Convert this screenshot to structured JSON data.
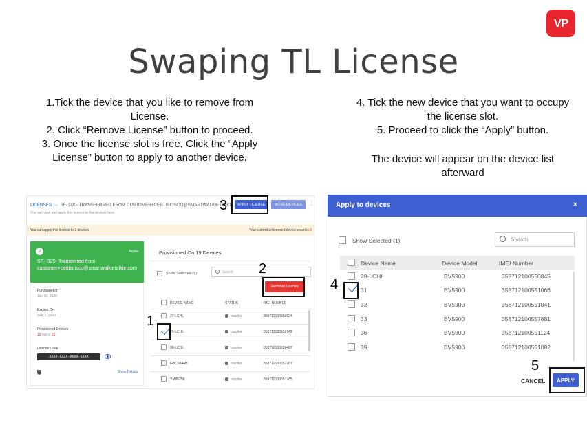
{
  "logo": {
    "text": "VP"
  },
  "title": "Swaping TL License",
  "steps_left": [
    "1.Tick the device that you like to remove from License.",
    "2. Click “Remove  License” button to proceed.",
    "3. Once the license slot is free, Click the “Apply License” button to apply to another device."
  ],
  "steps_right": [
    "4. Tick the new device that you want to occupy the license slot.",
    "5. Proceed to click the “Apply” button.",
    "The device will appear on the device list afterward"
  ],
  "annotations": {
    "n1": "1",
    "n2": "2",
    "n3": "3",
    "n4": "4",
    "n5": "5"
  },
  "left_shot": {
    "breadcrumb_root": "LICENSES",
    "breadcrumb_arrow": "→",
    "breadcrumb_title": "SF- D20- TRANSFERRED FROM CUSTOMER+CERTISCISCO@SMARTWALKIETALKIE.COM",
    "subtitle": "You can view and apply this license to the devices here",
    "apply_license_label": "APPLY LICENSE",
    "move_devices_label": "MOVE DEVICES",
    "kebab": "⋮",
    "info_left_pre": "You can apply this license to",
    "info_left_num": "1",
    "info_left_post": "devices",
    "info_right_pre": "Your current unlicensed device count is",
    "info_right_num": "6",
    "card": {
      "check": "✓",
      "status": "Active",
      "name": "SF- D20- Transferred from customer+certiscisco@smartwalkietalkie.com"
    },
    "purchased_label": "Purchased on",
    "purchased_value": "Jun 30, 2020",
    "expires_label": "Expires On",
    "expires_value": "Sep 7, 2020",
    "provisioned_label": "Provisioned Devices",
    "provisioned_count": "19",
    "provisioned_of": "out of",
    "provisioned_total": "20",
    "code_label": "License Code",
    "code_value": "XXXX-XXXX-XXXX-XXXX",
    "show_details": "Show Details",
    "prov_title": "Provisioned On 19 Devices",
    "show_selected": "Show Selected (1)",
    "search_placeholder": "Search",
    "remove_license_label": "Remove License",
    "headers": {
      "name": "DEVICE NAME",
      "status": "STATUS",
      "imei": "IMEI NUMBER"
    },
    "rows": [
      {
        "name": "27-LCHL",
        "status": "Inactive",
        "imei": "358712100558624"
      },
      {
        "name": "29-LCHL",
        "status": "Inactive",
        "imei": "358712100552742"
      },
      {
        "name": "30-LCHL",
        "status": "Inactive",
        "imei": "358712100556487"
      },
      {
        "name": "GBC9844H",
        "status": "Inactive",
        "imei": "358712100552767"
      },
      {
        "name": "YM8525K",
        "status": "Inactive",
        "imei": "358712100551785"
      }
    ]
  },
  "right_shot": {
    "title": "Apply to devices",
    "close": "×",
    "show_selected": "Show Selected (1)",
    "search_placeholder": "Search",
    "headers": {
      "name": "Device Name",
      "model": "Device Model",
      "imei": "IMEI Number"
    },
    "rows": [
      {
        "name": "28-LCHL",
        "model": "BV5900",
        "imei": "358712100550845"
      },
      {
        "name": "31",
        "model": "BV5900",
        "imei": "358712100551066"
      },
      {
        "name": "32",
        "model": "BV5900",
        "imei": "358712100551041"
      },
      {
        "name": "33",
        "model": "BV5900",
        "imei": "358712100557881"
      },
      {
        "name": "36",
        "model": "BV5900",
        "imei": "358712100551124"
      },
      {
        "name": "39",
        "model": "BV5900",
        "imei": "358712100551082"
      }
    ],
    "cancel_label": "CANCEL",
    "apply_label": "APPLY"
  }
}
